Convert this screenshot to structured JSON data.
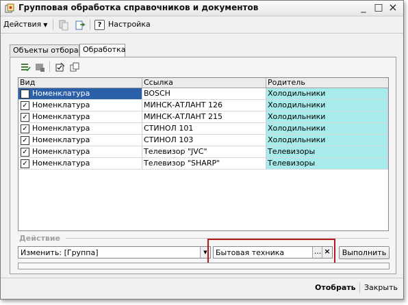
{
  "window": {
    "title": "Групповая обработка справочников и документов",
    "controls": [
      "_",
      "□",
      "×"
    ]
  },
  "toolbar": {
    "actions_label": "Действия",
    "settings_label": "Настройка",
    "help_label": "?"
  },
  "tabs": [
    {
      "label": "Объекты отбора",
      "active": false
    },
    {
      "label": "Обработка",
      "active": true
    }
  ],
  "table": {
    "columns": [
      "Вид",
      "Ссылка",
      "Родитель"
    ],
    "rows": [
      {
        "checked": true,
        "kind": "Номенклатура",
        "link": "BOSCH",
        "parent": "Холодильники"
      },
      {
        "checked": true,
        "kind": "Номенклатура",
        "link": "МИНСК-АТЛАНТ 126",
        "parent": "Холодильники"
      },
      {
        "checked": true,
        "kind": "Номенклатура",
        "link": "МИНСК-АТЛАНТ 215",
        "parent": "Холодильники"
      },
      {
        "checked": true,
        "kind": "Номенклатура",
        "link": "СТИНОЛ 101",
        "parent": "Холодильники"
      },
      {
        "checked": true,
        "kind": "Номенклатура",
        "link": "СТИНОЛ 103",
        "parent": "Холодильники"
      },
      {
        "checked": true,
        "kind": "Номенклатура",
        "link": "Телевизор \"JVC\"",
        "parent": "Телевизоры"
      },
      {
        "checked": true,
        "kind": "Номенклатура",
        "link": "Телевизор \"SHARP\"",
        "parent": "Телевизоры"
      }
    ]
  },
  "action_section": {
    "label": "Действие",
    "action_value": "Изменить: [Группа]",
    "value_field": "Бытовая техника",
    "select_btn": "...",
    "clear_btn": "×",
    "run_label": "Выполнить"
  },
  "footer": {
    "select_label": "Отобрать",
    "close_label": "Закрыть"
  },
  "colors": {
    "selection": "#2b5fa8",
    "parent_cell": "#a7ebea",
    "highlight_frame": "#b31b1b"
  }
}
